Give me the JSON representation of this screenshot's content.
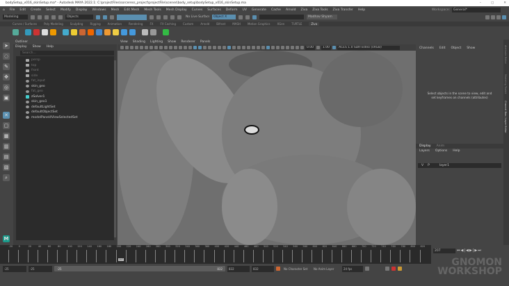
{
  "window": {
    "title": "bodySetup_v016_skinSetup.ma* - Autodesk MAYA 2022.1: C:\\projectFiles\\sorceress_project\\projectFile\\scenes\\body_setup\\bodySetup_v016_skinSetup.ma",
    "minimize": "–",
    "maximize": "▢",
    "close": "✕"
  },
  "menubar": {
    "items": [
      "File",
      "Edit",
      "Create",
      "Select",
      "Modify",
      "Display",
      "Windows",
      "Mesh",
      "Edit Mesh",
      "Mesh Tools",
      "Mesh Display",
      "Curves",
      "Surfaces",
      "Deform",
      "UV",
      "Generate",
      "Cache",
      "Arnold",
      "Ziva",
      "Ziva Tools",
      "Ziva Transfer",
      "Help"
    ],
    "workspace_label": "Workspace:",
    "workspace_value": "General*"
  },
  "statusline": {
    "mode": "Modeling",
    "objects": "Objects",
    "live_surface": "No Live Surface",
    "object_field": "Object X",
    "user": "Madhav Shyam"
  },
  "shelf": {
    "tabs": [
      "Curves / Surfaces",
      "Poly Modeling",
      "Sculpting",
      "Rigging",
      "Animation",
      "Rendering",
      "FX",
      "FX Caching",
      "Custom",
      "Arnold",
      "Bifrost",
      "MASH",
      "Motion Graphics",
      "XGen",
      "TURTLE",
      "Ziva"
    ],
    "active_tab": "Ziva"
  },
  "outliner": {
    "title": "Outliner",
    "menu": [
      "Display",
      "Show",
      "Help"
    ],
    "search_placeholder": "Search...",
    "items": [
      {
        "label": "persp",
        "icon": "camera-icon",
        "dim": true
      },
      {
        "label": "top",
        "icon": "camera-icon",
        "dim": true
      },
      {
        "label": "front",
        "icon": "camera-icon",
        "dim": true
      },
      {
        "label": "side",
        "icon": "camera-icon",
        "dim": true
      },
      {
        "label": "fat_input",
        "icon": "transform-icon",
        "dim": true
      },
      {
        "label": "skin_geo",
        "icon": "transform-icon",
        "dim": false
      },
      {
        "label": "fat_geo",
        "icon": "transform-icon",
        "dim": true
      },
      {
        "label": "zSolver1",
        "icon": "ziva-solver-icon",
        "dim": false
      },
      {
        "label": "skin_geo1",
        "icon": "transform-icon",
        "dim": false
      },
      {
        "label": "defaultLightSet",
        "icon": "set-icon",
        "dim": false
      },
      {
        "label": "defaultObjectSet",
        "icon": "set-icon",
        "dim": false
      },
      {
        "label": "modelPanel4ViewSelectedSet",
        "icon": "set-icon",
        "dim": false
      }
    ]
  },
  "viewport": {
    "menu": [
      "View",
      "Shading",
      "Lighting",
      "Show",
      "Renderer",
      "Panels"
    ],
    "exposure": "0.00",
    "gamma": "1.00",
    "color_space": "ACES 1.0 SDR-video (sRGB)"
  },
  "channel_box": {
    "menu": [
      "Channels",
      "Edit",
      "Object",
      "Show"
    ],
    "message": "Select objects in the scene to view, edit and set keyframes on channels (attributes)"
  },
  "side_tabs": [
    "Attribute Editor",
    "Modeling Toolkit",
    "Channel Box / Layer Editor"
  ],
  "layer_editor": {
    "tabs": [
      "Display",
      "Anim"
    ],
    "active_tab": "Display",
    "menu": [
      "Layers",
      "Options",
      "Help"
    ],
    "layer": {
      "v": "V",
      "p": "P",
      "name": "layer1"
    }
  },
  "timeline": {
    "ticks": [
      -20,
      0,
      20,
      40,
      60,
      80,
      100,
      120,
      140,
      160,
      180,
      200,
      220,
      240,
      260,
      280,
      300,
      320,
      340,
      360,
      380,
      400,
      420,
      440,
      460,
      480,
      500,
      520,
      540,
      560,
      580,
      600,
      620,
      640,
      660,
      680,
      700,
      720,
      740,
      760,
      780,
      800,
      820
    ],
    "range": [
      -25,
      832
    ],
    "current_frame": "207",
    "current_frame_field": "207"
  },
  "range_slider": {
    "start": "-25",
    "anim_start": "-25",
    "slider_start": "-25",
    "slider_end": "832",
    "end": "832",
    "anim_end": "832",
    "character_set": "No Character Set",
    "anim_layer": "No Anim Layer",
    "fps": "24 fps"
  },
  "watermark": {
    "line1": "GNOMON",
    "line2": "WORKSHOP"
  },
  "colors": {
    "accent": "#5a8fb0",
    "panel": "#444444",
    "field": "#2b2b2b",
    "viewport": "#6f6f6f"
  }
}
